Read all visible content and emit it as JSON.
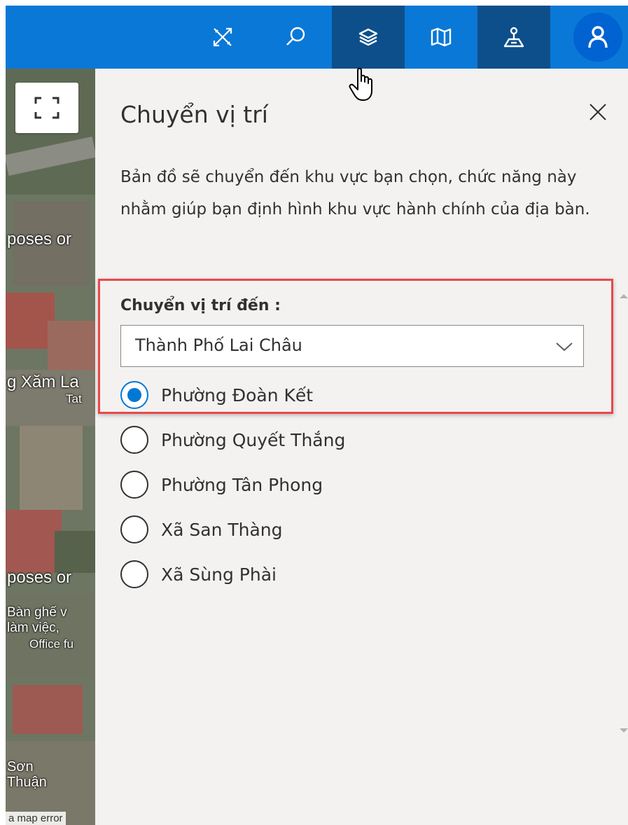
{
  "toolbar": {
    "buttons": [
      {
        "icon": "tools-icon",
        "active": false
      },
      {
        "icon": "search-icon",
        "active": false
      },
      {
        "icon": "layers-icon",
        "active": true
      },
      {
        "icon": "map-icon",
        "active": false
      },
      {
        "icon": "location-pin-icon",
        "active": true
      }
    ],
    "avatar_icon": "user-icon",
    "bar_color": "#0a78d7",
    "active_color": "#0d4f8a"
  },
  "map": {
    "labels": [
      "poses or",
      "g Xăm La",
      "Tat",
      "poses or",
      "Bàn ghế v",
      "làm việc,",
      "Office fu",
      "Sơn",
      "Thuận"
    ],
    "error_text": "a map error",
    "fullscreen_icon": "fullscreen-icon"
  },
  "panel": {
    "title": "Chuyển vị trí",
    "description": "Bản đồ sẽ chuyển đến khu vực bạn chọn, chức năng này nhằm giúp bạn định hình khu vực hành chính của địa bàn.",
    "field_label": "Chuyển vị trí đến :",
    "select_value": "Thành Phố Lai Châu",
    "options": [
      {
        "label": "Phường Đoàn Kết",
        "checked": true
      },
      {
        "label": "Phường Quyết Thắng",
        "checked": false
      },
      {
        "label": "Phường Tân Phong",
        "checked": false
      },
      {
        "label": "Xã San Thàng",
        "checked": false
      },
      {
        "label": "Xã Sùng Phài",
        "checked": false
      }
    ],
    "highlight_color": "#e8484b",
    "radio_color": "#0078d4"
  }
}
